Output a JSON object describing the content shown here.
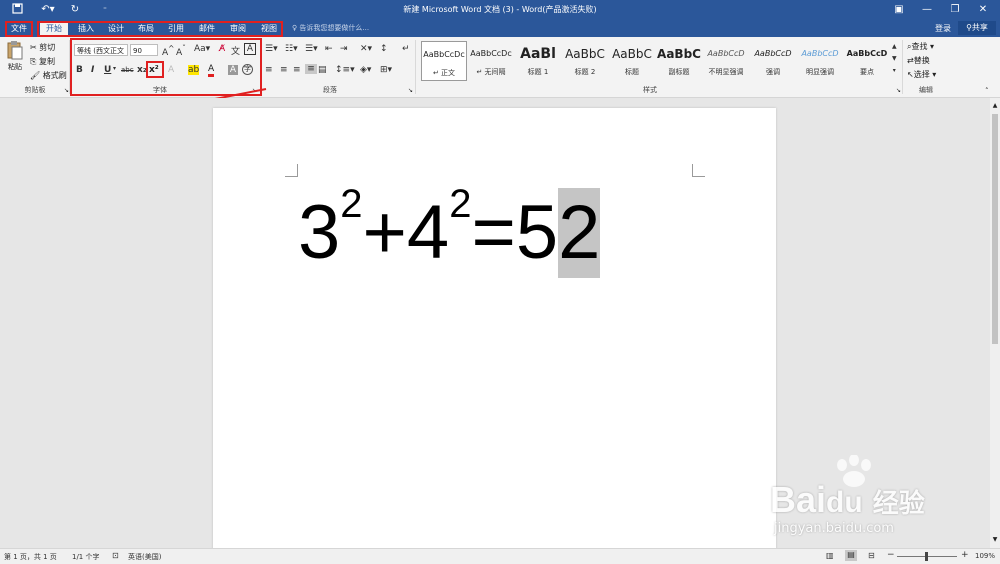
{
  "title_bar": {
    "title": "新建 Microsoft Word 文档 (3) - Word(产品激活失败)",
    "quick_access": [
      "save-icon",
      "undo-icon",
      "redo-icon",
      "customize-icon"
    ],
    "window_controls": [
      "ribbon-display-icon",
      "minimize-icon",
      "restore-icon",
      "close-icon"
    ]
  },
  "tabs": {
    "items": [
      "文件",
      "开始",
      "插入",
      "设计",
      "布局",
      "引用",
      "邮件",
      "审阅",
      "视图"
    ],
    "tell_me": "告诉我您想要做什么...",
    "login": "登录",
    "share": "共享"
  },
  "ribbon": {
    "clipboard": {
      "paste": "粘贴",
      "cut": "剪切",
      "copy": "复制",
      "format_painter": "格式刷",
      "label": "剪贴板"
    },
    "font": {
      "font_name": "等线 (西文正文",
      "font_size": "90",
      "label": "字体",
      "row2": [
        "B",
        "I",
        "U",
        "abc",
        "x₂",
        "x²"
      ]
    },
    "paragraph": {
      "label": "段落"
    },
    "styles": {
      "label": "样式",
      "items": [
        {
          "preview": "AaBbCcDc",
          "name": "↵ 正文"
        },
        {
          "preview": "AaBbCcDc",
          "name": "↵ 无间隔"
        },
        {
          "preview": "AaBl",
          "name": "标题 1"
        },
        {
          "preview": "AaBbC",
          "name": "标题 2"
        },
        {
          "preview": "AaBbC",
          "name": "标题"
        },
        {
          "preview": "AaBbC",
          "name": "副标题"
        },
        {
          "preview": "AaBbCcD",
          "name": "不明显强调"
        },
        {
          "preview": "AaBbCcD",
          "name": "强调"
        },
        {
          "preview": "AaBbCcD",
          "name": "明显强调"
        },
        {
          "preview": "AaBbCcD",
          "name": "要点"
        }
      ]
    },
    "editing": {
      "find": "查找",
      "replace": "替换",
      "select": "选择",
      "label": "编辑"
    }
  },
  "document": {
    "base1": "3",
    "exp1": "2",
    "plus": "+",
    "base2": "4",
    "exp2": "2",
    "equals": "=",
    "five": "5",
    "selected": "2"
  },
  "status_bar": {
    "page": "第 1 页，共 1 页",
    "words": "1/1 个字",
    "language": "英语(美国)",
    "zoom": "109%"
  },
  "watermark": {
    "brand": "Bai",
    "brand2": "du",
    "cn": "经验",
    "url": "jingyan.baidu.com"
  },
  "colors": {
    "accent": "#2b579a",
    "annotation": "#e02020",
    "selection": "#c5c5c5"
  }
}
